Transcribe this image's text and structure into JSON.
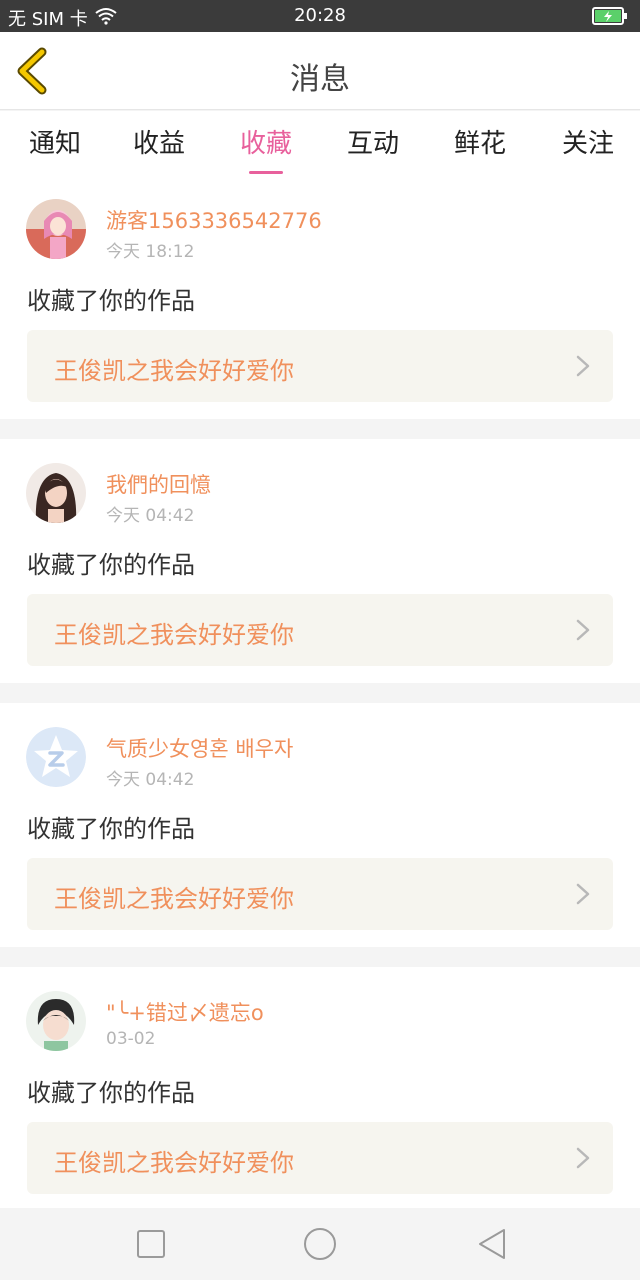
{
  "status_bar": {
    "carrier": "无 SIM 卡",
    "time": "20:28",
    "wifi_icon": "wifi-icon",
    "battery_icon": "battery-charging-icon"
  },
  "header": {
    "title": "消息",
    "back_icon": "back-chevron-icon",
    "back_color": "#f5c800"
  },
  "tabs": [
    {
      "label": "通知",
      "active": false
    },
    {
      "label": "收益",
      "active": false
    },
    {
      "label": "收藏",
      "active": true
    },
    {
      "label": "互动",
      "active": false
    },
    {
      "label": "鲜花",
      "active": false
    },
    {
      "label": "关注",
      "active": false
    }
  ],
  "accent_color": "#e8609c",
  "name_color": "#f0905c",
  "items": [
    {
      "user": "游客1563336542776",
      "time": "今天 18:12",
      "action": "收藏了你的作品",
      "work_title": "王俊凯之我会好好爱你"
    },
    {
      "user": "我們的回憶",
      "time": "今天 04:42",
      "action": "收藏了你的作品",
      "work_title": "王俊凯之我会好好爱你"
    },
    {
      "user": "气质少女영혼 배우자",
      "time": "今天 04:42",
      "action": "收藏了你的作品",
      "work_title": "王俊凯之我会好好爱你"
    },
    {
      "user": "\"╰+错过〆遗忘o",
      "time": "03-02",
      "action": "收藏了你的作品",
      "work_title": "王俊凯之我会好好爱你"
    }
  ],
  "nav_icons": [
    "recent-apps-square-icon",
    "home-circle-icon",
    "back-triangle-icon"
  ]
}
